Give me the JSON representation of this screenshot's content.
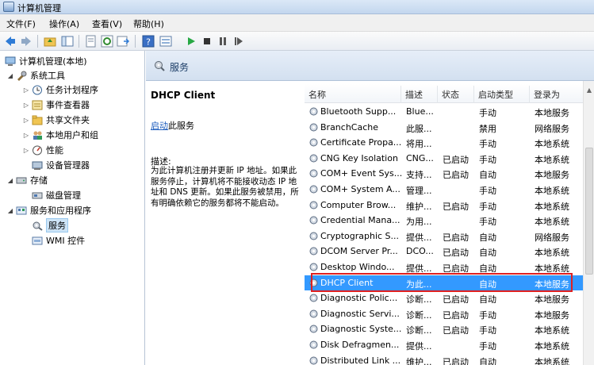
{
  "window": {
    "title": "计算机管理"
  },
  "menu": [
    "文件(F)",
    "操作(A)",
    "查看(V)",
    "帮助(H)"
  ],
  "tree": [
    {
      "label": "计算机管理(本地)",
      "icon": "computer-icon"
    },
    {
      "label": "系统工具",
      "icon": "tools-icon"
    },
    {
      "label": "任务计划程序",
      "icon": "clock-icon"
    },
    {
      "label": "事件查看器",
      "icon": "event-icon"
    },
    {
      "label": "共享文件夹",
      "icon": "folder-icon"
    },
    {
      "label": "本地用户和组",
      "icon": "users-icon"
    },
    {
      "label": "性能",
      "icon": "performance-icon"
    },
    {
      "label": "设备管理器",
      "icon": "device-icon"
    },
    {
      "label": "存储",
      "icon": "storage-icon"
    },
    {
      "label": "磁盘管理",
      "icon": "disk-icon"
    },
    {
      "label": "服务和应用程序",
      "icon": "apps-icon"
    },
    {
      "label": "服务",
      "icon": "services-icon"
    },
    {
      "label": "WMI 控件",
      "icon": "wmi-icon"
    }
  ],
  "header": {
    "title": "服务"
  },
  "detail": {
    "service_name": "DHCP Client",
    "start_link": "启动",
    "start_suffix": "此服务",
    "desc_label": "描述:",
    "desc_text": "为此计算机注册并更新 IP 地址。如果此服务停止，计算机将不能接收动态 IP 地址和 DNS 更新。如果此服务被禁用，所有明确依赖它的服务都将不能启动。"
  },
  "columns": [
    "名称",
    "描述",
    "状态",
    "启动类型",
    "登录为"
  ],
  "services": [
    [
      "Bluetooth Supp...",
      "Blue...",
      "",
      "手动",
      "本地服务"
    ],
    [
      "BranchCache",
      "此服...",
      "",
      "禁用",
      "网络服务"
    ],
    [
      "Certificate Propa...",
      "将用...",
      "",
      "手动",
      "本地系统"
    ],
    [
      "CNG Key Isolation",
      "CNG...",
      "已启动",
      "手动",
      "本地系统"
    ],
    [
      "COM+ Event Sys...",
      "支持...",
      "已启动",
      "自动",
      "本地服务"
    ],
    [
      "COM+ System A...",
      "管理...",
      "",
      "手动",
      "本地系统"
    ],
    [
      "Computer Brow...",
      "维护...",
      "已启动",
      "手动",
      "本地系统"
    ],
    [
      "Credential Mana...",
      "为用...",
      "",
      "手动",
      "本地系统"
    ],
    [
      "Cryptographic S...",
      "提供...",
      "已启动",
      "自动",
      "网络服务"
    ],
    [
      "DCOM Server Pr...",
      "DCO...",
      "已启动",
      "自动",
      "本地系统"
    ],
    [
      "Desktop Windo...",
      "提供...",
      "已启动",
      "自动",
      "本地系统"
    ],
    [
      "DHCP Client",
      "为此...",
      "",
      "自动",
      "本地服务"
    ],
    [
      "Diagnostic Polic...",
      "诊断...",
      "已启动",
      "自动",
      "本地服务"
    ],
    [
      "Diagnostic Servi...",
      "诊断...",
      "已启动",
      "手动",
      "本地服务"
    ],
    [
      "Diagnostic Syste...",
      "诊断...",
      "已启动",
      "手动",
      "本地系统"
    ],
    [
      "Disk Defragmen...",
      "提供...",
      "",
      "手动",
      "本地系统"
    ],
    [
      "Distributed Link ...",
      "维护...",
      "已启动",
      "自动",
      "本地系统"
    ]
  ],
  "highlighted_service_index": 11,
  "colors": {
    "highlight": "#3399ff",
    "callout": "#e02020"
  }
}
